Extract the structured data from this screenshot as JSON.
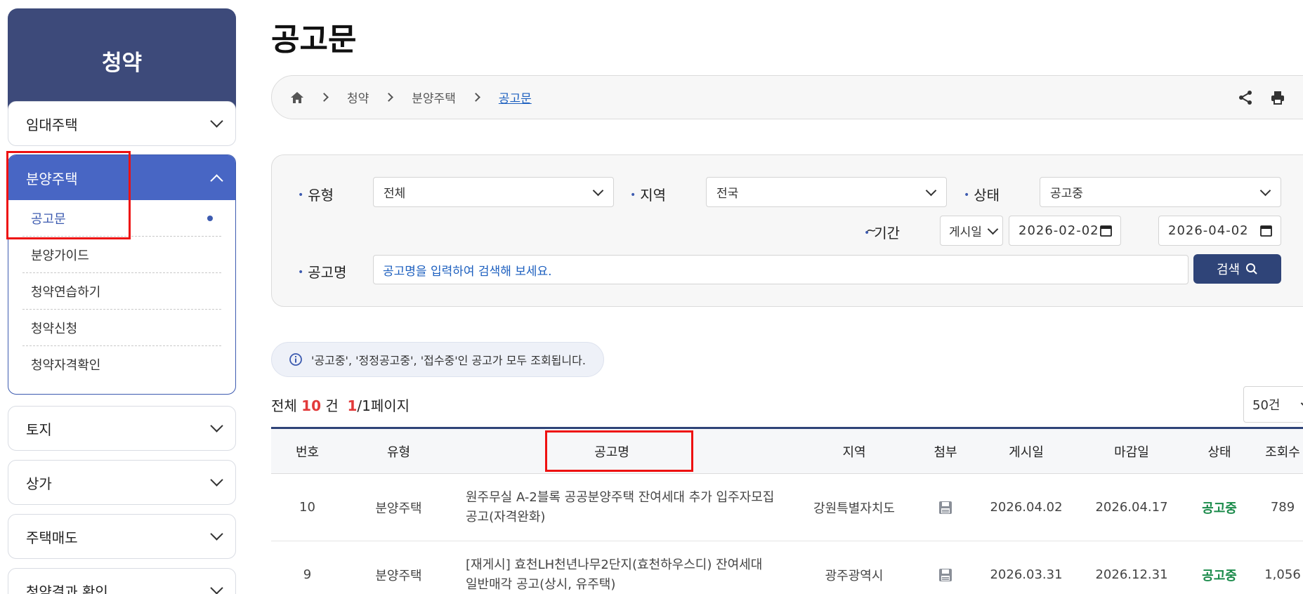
{
  "sidebar": {
    "title": "청약",
    "menus": [
      {
        "label": "임대주택"
      },
      {
        "label": "분양주택"
      },
      {
        "label": "토지"
      },
      {
        "label": "상가"
      },
      {
        "label": "주택매도"
      },
      {
        "label": "청약결과 확인"
      }
    ],
    "submenu": [
      "공고문",
      "분양가이드",
      "청약연습하기",
      "청약신청",
      "청약자격확인"
    ]
  },
  "page": {
    "title": "공고문"
  },
  "breadcrumb": [
    "청약",
    "분양주택",
    "공고문"
  ],
  "filters": {
    "type_label": "유형",
    "type_value": "전체",
    "region_label": "지역",
    "region_value": "전국",
    "status_label": "상태",
    "status_value": "공고중",
    "period_label": "기간",
    "period_type": "게시일",
    "date_from": "2026-02-02",
    "date_sep": "~",
    "date_to": "2026-04-02",
    "name_label": "공고명",
    "name_placeholder": "공고명을 입력하여 검색해 보세요.",
    "search_label": "검색"
  },
  "notice": "'공고중', '정정공고중', '접수중'인 공고가 모두 조회됩니다.",
  "summary": {
    "prefix": "전체",
    "count": "10",
    "unit": "건",
    "page": "1",
    "pages": "/1페이지"
  },
  "per_page": "50건",
  "table": {
    "headers": [
      "번호",
      "유형",
      "공고명",
      "지역",
      "첨부",
      "게시일",
      "마감일",
      "상태",
      "조회수"
    ],
    "rows": [
      {
        "no": "10",
        "type": "분양주택",
        "title1": "원주무실 A-2블록 공공분양주택 잔여세대 추가 입주자모집",
        "title2": "공고(자격완화)",
        "region": "강원특별자치도",
        "posted": "2026.04.02",
        "deadline": "2026.04.17",
        "status": "공고중",
        "views": "789"
      },
      {
        "no": "9",
        "type": "분양주택",
        "title1": "[재게시] 효천LH천년나무2단지(효천하우스디) 잔여세대",
        "title2": "일반매각 공고(상시, 유주택)",
        "region": "광주광역시",
        "posted": "2026.03.31",
        "deadline": "2026.12.31",
        "status": "공고중",
        "views": "1,056"
      }
    ]
  },
  "colors": {
    "brand": "#3d4a7a",
    "accent": "#4866c4",
    "status_green": "#1a8a4a",
    "highlight_red": "#e11"
  }
}
